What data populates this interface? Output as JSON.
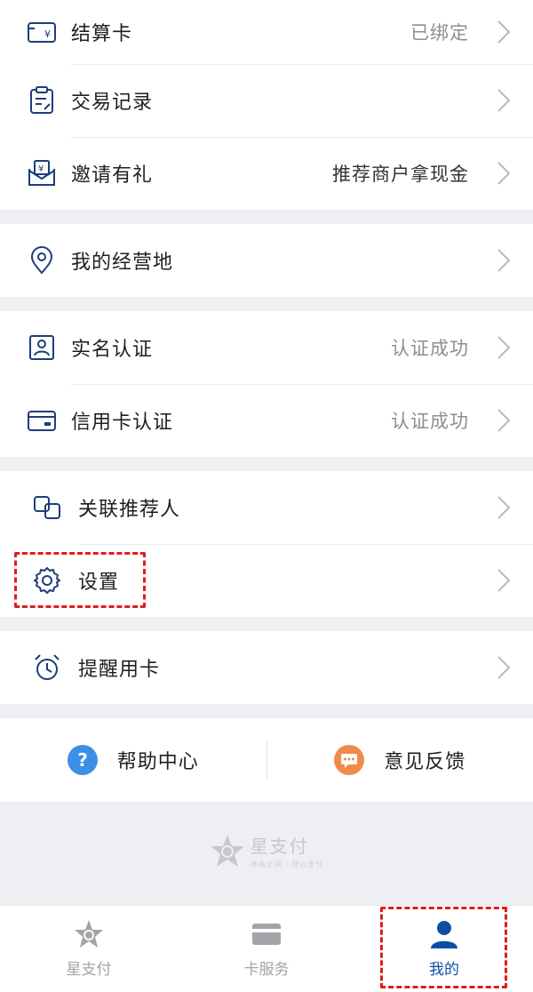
{
  "menu_group_1": {
    "settlement_card": {
      "label": "结算卡",
      "value": "已绑定"
    },
    "transaction_records": {
      "label": "交易记录"
    },
    "invite_reward": {
      "label": "邀请有礼",
      "value": "推荐商户拿现金"
    }
  },
  "menu_group_2": {
    "business_location": {
      "label": "我的经营地"
    }
  },
  "menu_group_3": {
    "real_name_auth": {
      "label": "实名认证",
      "value": "认证成功"
    },
    "credit_card_auth": {
      "label": "信用卡认证",
      "value": "认证成功"
    }
  },
  "menu_group_4": {
    "linked_referrer": {
      "label": "关联推荐人"
    },
    "settings": {
      "label": "设置"
    }
  },
  "menu_group_5": {
    "card_reminder": {
      "label": "提醒用卡"
    }
  },
  "help_bar": {
    "help_center": "帮助中心",
    "feedback": "意见反馈"
  },
  "brand": {
    "name": "星支付",
    "slogan": "弹指之间 · 随心支付"
  },
  "tabbar": {
    "tabs": [
      {
        "label": "星支付",
        "icon": "star-pay-logo-icon",
        "active": false
      },
      {
        "label": "卡服务",
        "icon": "card-icon",
        "active": false
      },
      {
        "label": "我的",
        "icon": "user-icon",
        "active": true
      }
    ]
  },
  "colors": {
    "accent": "#0e4da4",
    "icon_blue": "#1c3f7a",
    "help_icon": "#3b8fe8",
    "feedback_icon": "#f08a4b",
    "highlight": "#e11b1b"
  }
}
